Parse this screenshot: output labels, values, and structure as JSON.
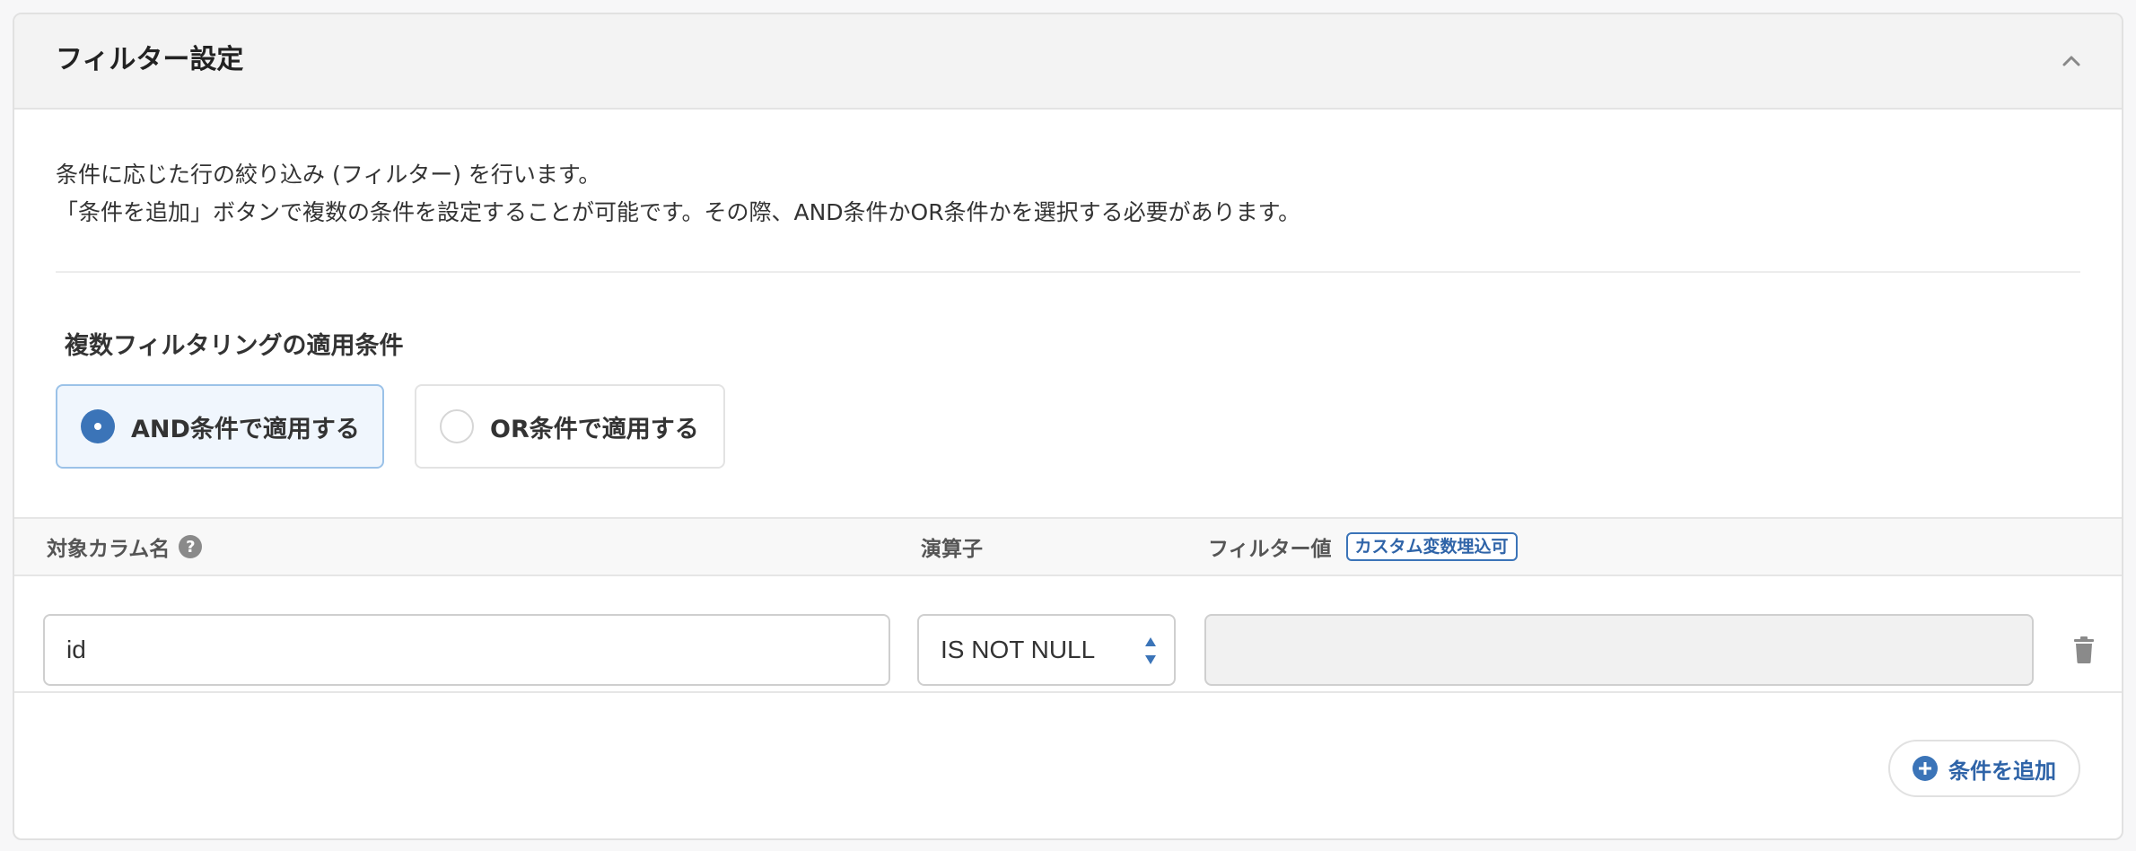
{
  "panel": {
    "title": "フィルター設定",
    "collapse_icon": "chevron-up-icon"
  },
  "description": {
    "line1": "条件に応じた行の絞り込み (フィルター) を行います。",
    "line2": "「条件を追加」ボタンで複数の条件を設定することが可能です。その際、AND条件かOR条件かを選択する必要があります。"
  },
  "multi_filter": {
    "label": "複数フィルタリングの適用条件",
    "options": [
      {
        "label": "AND条件で適用する",
        "selected": true
      },
      {
        "label": "OR条件で適用する",
        "selected": false
      }
    ]
  },
  "table": {
    "headers": {
      "column": "対象カラム名",
      "help": "?",
      "operator": "演算子",
      "value": "フィルター値",
      "value_badge": "カスタム変数埋込可"
    },
    "rows": [
      {
        "column": "id",
        "operator": "IS NOT NULL",
        "value": ""
      }
    ]
  },
  "add_condition_label": "条件を追加",
  "colors": {
    "accent": "#3b74b8",
    "selected_bg": "#f0f6fd",
    "header_bg": "#f3f3f3"
  }
}
